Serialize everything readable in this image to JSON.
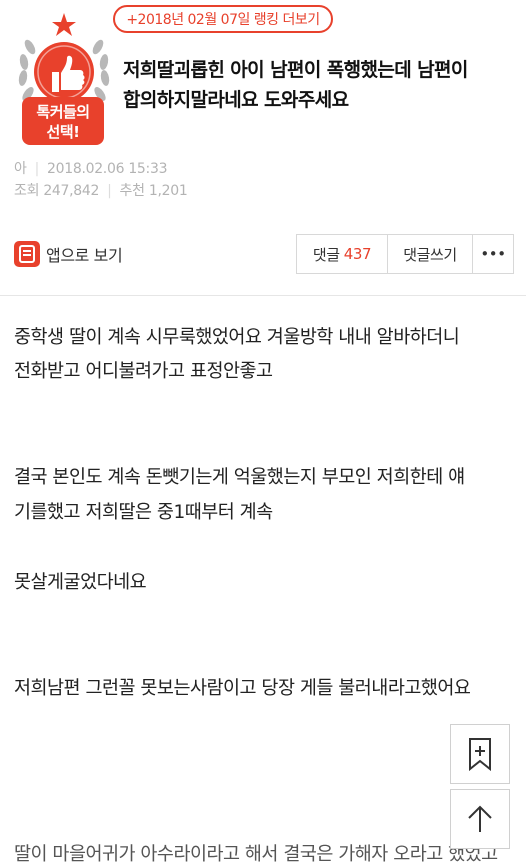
{
  "ranking_link": "+2018년 02월 07일 랭킹 더보기",
  "badge": {
    "line1": "톡커들의",
    "line2": "선택!"
  },
  "post": {
    "title_line1": "저희딸괴롭힌 아이 남편이 폭행했는데 남편이",
    "title_line2": "합의하지말라네요 도와주세요",
    "author": "아",
    "date": "2018.02.06 15:33",
    "views_label": "조회",
    "views": "247,842",
    "recommend_label": "추천",
    "recommend": "1,201"
  },
  "toolbar": {
    "app_view": "앱으로 보기",
    "comment_label": "댓글",
    "comment_count": "437",
    "write_comment": "댓글쓰기",
    "more": "•••"
  },
  "body": [
    "중학생 딸이 계속 시무룩했었어요 겨울방학 내내 알바하더니",
    "전화받고 어디불려가고 표정안좋고",
    "결국 본인도 계속 돈뺏기는게 억울했는지 부모인 저희한테 얘",
    "기를했고 저희딸은 중1때부터 계속",
    "못살게굴었다네요",
    "저희남편 그런꼴 못보는사람이고 당장 게들 불러내라고했어요",
    "딸이 마을어귀가 아수라이라고 해서 결국은 가해자 오라고 했었고"
  ],
  "colors": {
    "accent": "#e8412c"
  },
  "icons": {
    "bookmark": "bookmark-add-icon",
    "top": "arrow-up-icon"
  }
}
